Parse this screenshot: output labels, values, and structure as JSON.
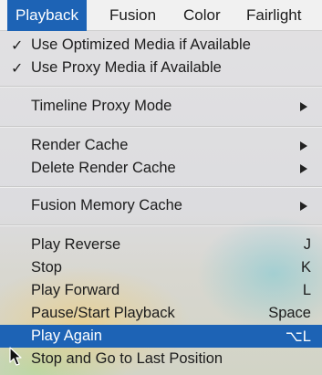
{
  "menubar": {
    "items": [
      "Playback",
      "Fusion",
      "Color",
      "Fairlight"
    ]
  },
  "menu": {
    "items": [
      {
        "label": "Use Optimized Media if Available",
        "checked": true
      },
      {
        "label": "Use Proxy Media if Available",
        "checked": true
      },
      {
        "label": "Timeline Proxy Mode",
        "submenu": true
      },
      {
        "label": "Render Cache",
        "submenu": true
      },
      {
        "label": "Delete Render Cache",
        "submenu": true
      },
      {
        "label": "Fusion Memory Cache",
        "submenu": true
      },
      {
        "label": "Play Reverse",
        "shortcut": "J"
      },
      {
        "label": "Stop",
        "shortcut": "K"
      },
      {
        "label": "Play Forward",
        "shortcut": "L"
      },
      {
        "label": "Pause/Start Playback",
        "shortcut": "Space"
      },
      {
        "label": "Play Again",
        "shortcut": "⌥L",
        "highlighted": true
      },
      {
        "label": "Stop and Go to Last Position"
      }
    ],
    "check_glyph": "✓"
  },
  "colors": {
    "highlight": "#1d63b5",
    "menubar_bg": "#f1f1f1",
    "text": "#1c1c1c"
  },
  "icons": [
    "checkmark-icon",
    "submenu-arrow-icon",
    "mouse-pointer-icon"
  ]
}
